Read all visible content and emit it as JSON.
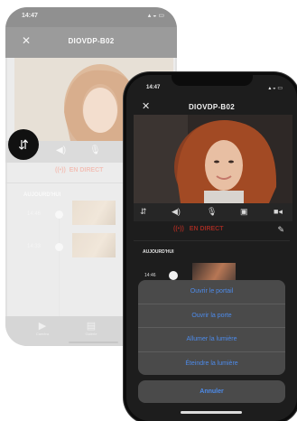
{
  "back_phone": {
    "status_time": "14:47",
    "title": "DIOVDP-B02",
    "live_label": "EN DIRECT",
    "section_title": "AUJOURD'HUI",
    "rows": [
      {
        "time": "14:46"
      },
      {
        "time": "14:33"
      }
    ],
    "nav": [
      {
        "label": "Caméra"
      },
      {
        "label": "Galerie"
      }
    ]
  },
  "front_phone": {
    "status_time": "14:47",
    "title": "DIOVDP-B02",
    "live_label": "EN DIRECT",
    "section_title": "AUJOURD'HUI",
    "row_time": "14:46",
    "action_sheet": {
      "actions": [
        {
          "label": "Ouvrir le portail"
        },
        {
          "label": "Ouvrir la porte"
        },
        {
          "label": "Allumer la lumière"
        },
        {
          "label": "Éteindre la lumière"
        }
      ],
      "cancel_label": "Annuler"
    }
  },
  "icons": {
    "close": "close-icon",
    "switch_camera": "switch-camera-icon",
    "speaker": "speaker-icon",
    "microphone": "microphone-icon",
    "snapshot": "snapshot-icon",
    "record": "video-record-icon",
    "edit": "pencil-icon",
    "live": "live-radio-icon"
  },
  "colors": {
    "accent_blue": "#4d8bea",
    "live_red": "#9c2b22",
    "sheet_bg": "#4a4a4a",
    "dark_bg": "#1d1d1d"
  }
}
